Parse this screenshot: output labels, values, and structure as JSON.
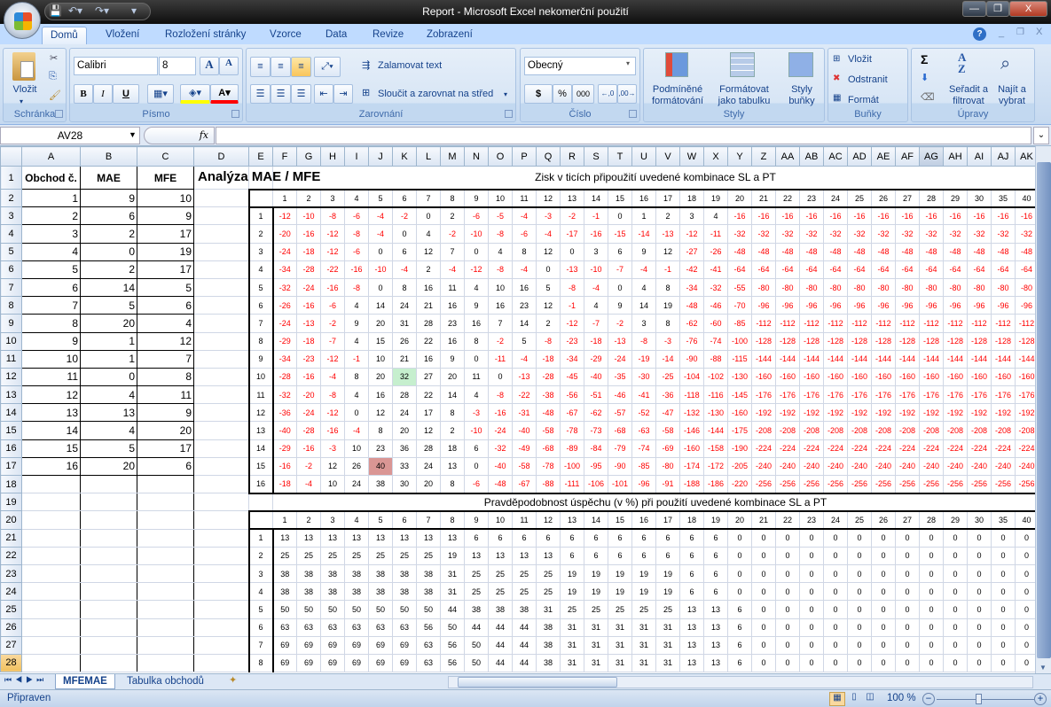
{
  "window": {
    "title": "Report - Microsoft Excel nekomerční použití",
    "minimize": "—",
    "restore": "❐",
    "close": "X"
  },
  "quick_access": {
    "save_icon": "save-icon",
    "undo_icon": "undo-icon",
    "redo_icon": "redo-icon"
  },
  "ribbon_tabs": [
    "Domů",
    "Vložení",
    "Rozložení stránky",
    "Vzorce",
    "Data",
    "Revize",
    "Zobrazení"
  ],
  "ribbon": {
    "clipboard": {
      "label": "Schránka",
      "paste": "Vložit"
    },
    "font": {
      "label": "Písmo",
      "font_name": "Calibri",
      "font_size": "8",
      "bold": "B",
      "italic": "I",
      "underline": "U",
      "font_color": "#ff0000",
      "fill_color": "#ffff00"
    },
    "alignment": {
      "label": "Zarovnání",
      "wrap_text": "Zalamovat text",
      "merge_center": "Sloučit a zarovnat na střed"
    },
    "number": {
      "label": "Číslo",
      "format": "Obecný",
      "currency": "$",
      "percent": "%",
      "thousands": "000"
    },
    "styles": {
      "label": "Styly",
      "conditional_1": "Podmíněné",
      "conditional_2": "formátování",
      "table_1": "Formátovat",
      "table_2": "jako tabulku",
      "cell_1": "Styly",
      "cell_2": "buňky"
    },
    "cells": {
      "label": "Buňky",
      "insert": "Vložit",
      "delete": "Odstranit",
      "format": "Formát"
    },
    "editing": {
      "label": "Úpravy",
      "sort_1": "Seřadit a",
      "sort_2": "filtrovat",
      "find_1": "Najít a",
      "find_2": "vybrat",
      "sum": "Σ"
    }
  },
  "formula_bar": {
    "name_box": "AV28",
    "fx": "fx",
    "formula": ""
  },
  "sheet": {
    "columns": [
      "A",
      "B",
      "C",
      "D",
      "E",
      "F",
      "G",
      "H",
      "I",
      "J",
      "K",
      "L",
      "M",
      "N",
      "O",
      "P",
      "Q",
      "R",
      "S",
      "T",
      "U",
      "V",
      "W",
      "X",
      "Y",
      "Z",
      "AA",
      "AB",
      "AC",
      "AD",
      "AE",
      "AF",
      "AG",
      "AH",
      "AI",
      "AJ",
      "AK"
    ],
    "rows": [
      1,
      2,
      3,
      4,
      5,
      6,
      7,
      8,
      9,
      10,
      11,
      12,
      13,
      14,
      15,
      16,
      17,
      18,
      19,
      20,
      21,
      22,
      23,
      24,
      25,
      26,
      27,
      28
    ],
    "selected_row": 28,
    "hover_column": "AG",
    "trades": {
      "headers": [
        "Obchod č.",
        "MAE",
        "MFE"
      ],
      "rows": [
        [
          1,
          9,
          10
        ],
        [
          2,
          6,
          9
        ],
        [
          3,
          2,
          17
        ],
        [
          4,
          0,
          19
        ],
        [
          5,
          2,
          17
        ],
        [
          6,
          14,
          5
        ],
        [
          7,
          5,
          6
        ],
        [
          8,
          20,
          4
        ],
        [
          9,
          1,
          12
        ],
        [
          10,
          1,
          7
        ],
        [
          11,
          0,
          8
        ],
        [
          12,
          4,
          11
        ],
        [
          13,
          13,
          9
        ],
        [
          14,
          4,
          20
        ],
        [
          15,
          5,
          17
        ],
        [
          16,
          20,
          6
        ]
      ]
    },
    "analysis_title": "Analýza MAE / MFE",
    "profit_table": {
      "title": "Zisk v ticích připoužití uvedené kombinace SL a PT",
      "pt_values": [
        1,
        2,
        3,
        4,
        5,
        6,
        7,
        8,
        9,
        10,
        11,
        12,
        13,
        14,
        15,
        16,
        17,
        18,
        19,
        20,
        21,
        22,
        23,
        24,
        25,
        26,
        27,
        28,
        29,
        30,
        35,
        40
      ],
      "sl_values": [
        1,
        2,
        3,
        4,
        5,
        6,
        7,
        8,
        9,
        10,
        11,
        12,
        13,
        14,
        15,
        16
      ],
      "values": [
        [
          -12,
          -10,
          -8,
          -6,
          -4,
          -2,
          0,
          2,
          -6,
          -5,
          -4,
          -3,
          -2,
          -1,
          0,
          1,
          2,
          3,
          4,
          -16,
          -16,
          -16,
          -16,
          -16,
          -16,
          -16,
          -16,
          -16,
          -16,
          -16,
          -16,
          -16
        ],
        [
          -20,
          -16,
          -12,
          -8,
          -4,
          0,
          4,
          -2,
          -10,
          -8,
          -6,
          -4,
          -17,
          -16,
          -15,
          -14,
          -13,
          -12,
          -11,
          -32,
          -32,
          -32,
          -32,
          -32,
          -32,
          -32,
          -32,
          -32,
          -32,
          -32,
          -32,
          -32
        ],
        [
          -24,
          -18,
          -12,
          -6,
          0,
          6,
          12,
          7,
          0,
          4,
          8,
          12,
          0,
          3,
          6,
          9,
          12,
          -27,
          -26,
          -48,
          -48,
          -48,
          -48,
          -48,
          -48,
          -48,
          -48,
          -48,
          -48,
          -48,
          -48,
          -48
        ],
        [
          -34,
          -28,
          -22,
          -16,
          -10,
          -4,
          2,
          -4,
          -12,
          -8,
          -4,
          0,
          -13,
          -10,
          -7,
          -4,
          -1,
          -42,
          -41,
          -64,
          -64,
          -64,
          -64,
          -64,
          -64,
          -64,
          -64,
          -64,
          -64,
          -64,
          -64,
          -64
        ],
        [
          -32,
          -24,
          -16,
          -8,
          0,
          8,
          16,
          11,
          4,
          10,
          16,
          5,
          -8,
          -4,
          0,
          4,
          8,
          -34,
          -32,
          -55,
          -80,
          -80,
          -80,
          -80,
          -80,
          -80,
          -80,
          -80,
          -80,
          -80,
          -80,
          -80
        ],
        [
          -26,
          -16,
          -6,
          4,
          14,
          24,
          21,
          16,
          9,
          16,
          23,
          12,
          -1,
          4,
          9,
          14,
          19,
          -48,
          -46,
          -70,
          -96,
          -96,
          -96,
          -96,
          -96,
          -96,
          -96,
          -96,
          -96,
          -96,
          -96,
          -96
        ],
        [
          -24,
          -13,
          -2,
          9,
          20,
          31,
          28,
          23,
          16,
          7,
          14,
          2,
          -12,
          -7,
          -2,
          3,
          8,
          -62,
          -60,
          -85,
          -112,
          -112,
          -112,
          -112,
          -112,
          -112,
          -112,
          -112,
          -112,
          -112,
          -112,
          -112
        ],
        [
          -29,
          -18,
          -7,
          4,
          15,
          26,
          22,
          16,
          8,
          -2,
          5,
          -8,
          -23,
          -18,
          -13,
          -8,
          -3,
          -76,
          -74,
          -100,
          -128,
          -128,
          -128,
          -128,
          -128,
          -128,
          -128,
          -128,
          -128,
          -128,
          -128,
          -128
        ],
        [
          -34,
          -23,
          -12,
          -1,
          10,
          21,
          16,
          9,
          0,
          -11,
          -4,
          -18,
          -34,
          -29,
          -24,
          -19,
          -14,
          -90,
          -88,
          -115,
          -144,
          -144,
          -144,
          -144,
          -144,
          -144,
          -144,
          -144,
          -144,
          -144,
          -144,
          -144
        ],
        [
          -28,
          -16,
          -4,
          8,
          20,
          32,
          27,
          20,
          11,
          0,
          -13,
          -28,
          -45,
          -40,
          -35,
          -30,
          -25,
          -104,
          -102,
          -130,
          -160,
          -160,
          -160,
          -160,
          -160,
          -160,
          -160,
          -160,
          -160,
          -160,
          -160,
          -160
        ],
        [
          -32,
          -20,
          -8,
          4,
          16,
          28,
          22,
          14,
          4,
          -8,
          -22,
          -38,
          -56,
          -51,
          -46,
          -41,
          -36,
          -118,
          -116,
          -145,
          -176,
          -176,
          -176,
          -176,
          -176,
          -176,
          -176,
          -176,
          -176,
          -176,
          -176,
          -176
        ],
        [
          -36,
          -24,
          -12,
          0,
          12,
          24,
          17,
          8,
          -3,
          -16,
          -31,
          -48,
          -67,
          -62,
          -57,
          -52,
          -47,
          -132,
          -130,
          -160,
          -192,
          -192,
          -192,
          -192,
          -192,
          -192,
          -192,
          -192,
          -192,
          -192,
          -192,
          -192
        ],
        [
          -40,
          -28,
          -16,
          -4,
          8,
          20,
          12,
          2,
          -10,
          -24,
          -40,
          -58,
          -78,
          -73,
          -68,
          -63,
          -58,
          -146,
          -144,
          -175,
          -208,
          -208,
          -208,
          -208,
          -208,
          -208,
          -208,
          -208,
          -208,
          -208,
          -208,
          -208
        ],
        [
          -29,
          -16,
          -3,
          10,
          23,
          36,
          28,
          18,
          6,
          -32,
          -49,
          -68,
          -89,
          -84,
          -79,
          -74,
          -69,
          -160,
          -158,
          -190,
          -224,
          -224,
          -224,
          -224,
          -224,
          -224,
          -224,
          -224,
          -224,
          -224,
          -224,
          -224
        ],
        [
          -16,
          -2,
          12,
          26,
          40,
          33,
          24,
          13,
          0,
          -40,
          -58,
          -78,
          -100,
          -95,
          -90,
          -85,
          -80,
          -174,
          -172,
          -205,
          -240,
          -240,
          -240,
          -240,
          -240,
          -240,
          -240,
          -240,
          -240,
          -240,
          -240,
          -240
        ],
        [
          -18,
          -4,
          10,
          24,
          38,
          30,
          20,
          8,
          -6,
          -48,
          -67,
          -88,
          -111,
          -106,
          -101,
          -96,
          -91,
          -188,
          -186,
          -220,
          -256,
          -256,
          -256,
          -256,
          -256,
          -256,
          -256,
          -256,
          -256,
          -256,
          -256,
          -256
        ]
      ],
      "highlights": [
        {
          "sl": 10,
          "pt": 6,
          "color": "#c6efce"
        },
        {
          "sl": 15,
          "pt": 5,
          "color": "#da9694"
        }
      ]
    },
    "probability_table": {
      "title": "Pravděpodobnost úspěchu (v %) při použití uvedené kombinace SL a PT",
      "pt_values": [
        1,
        2,
        3,
        4,
        5,
        6,
        7,
        8,
        9,
        10,
        11,
        12,
        13,
        14,
        15,
        16,
        17,
        18,
        19,
        20,
        21,
        22,
        23,
        24,
        25,
        26,
        27,
        28,
        29,
        30,
        35,
        40
      ],
      "sl_values": [
        1,
        2,
        3,
        4,
        5,
        6,
        7,
        8
      ],
      "values": [
        [
          13,
          13,
          13,
          13,
          13,
          13,
          13,
          13,
          6,
          6,
          6,
          6,
          6,
          6,
          6,
          6,
          6,
          6,
          6,
          0,
          0,
          0,
          0,
          0,
          0,
          0,
          0,
          0,
          0,
          0,
          0,
          0
        ],
        [
          25,
          25,
          25,
          25,
          25,
          25,
          25,
          19,
          13,
          13,
          13,
          13,
          6,
          6,
          6,
          6,
          6,
          6,
          6,
          0,
          0,
          0,
          0,
          0,
          0,
          0,
          0,
          0,
          0,
          0,
          0,
          0
        ],
        [
          38,
          38,
          38,
          38,
          38,
          38,
          38,
          31,
          25,
          25,
          25,
          25,
          19,
          19,
          19,
          19,
          19,
          6,
          6,
          0,
          0,
          0,
          0,
          0,
          0,
          0,
          0,
          0,
          0,
          0,
          0,
          0
        ],
        [
          38,
          38,
          38,
          38,
          38,
          38,
          38,
          31,
          25,
          25,
          25,
          25,
          19,
          19,
          19,
          19,
          19,
          6,
          6,
          0,
          0,
          0,
          0,
          0,
          0,
          0,
          0,
          0,
          0,
          0,
          0,
          0
        ],
        [
          50,
          50,
          50,
          50,
          50,
          50,
          50,
          44,
          38,
          38,
          38,
          31,
          25,
          25,
          25,
          25,
          25,
          13,
          13,
          6,
          0,
          0,
          0,
          0,
          0,
          0,
          0,
          0,
          0,
          0,
          0,
          0
        ],
        [
          63,
          63,
          63,
          63,
          63,
          63,
          56,
          50,
          44,
          44,
          44,
          38,
          31,
          31,
          31,
          31,
          31,
          13,
          13,
          6,
          0,
          0,
          0,
          0,
          0,
          0,
          0,
          0,
          0,
          0,
          0,
          0
        ],
        [
          69,
          69,
          69,
          69,
          69,
          69,
          63,
          56,
          50,
          44,
          44,
          38,
          31,
          31,
          31,
          31,
          31,
          13,
          13,
          6,
          0,
          0,
          0,
          0,
          0,
          0,
          0,
          0,
          0,
          0,
          0,
          0
        ],
        [
          69,
          69,
          69,
          69,
          69,
          69,
          63,
          56,
          50,
          44,
          44,
          38,
          31,
          31,
          31,
          31,
          31,
          13,
          13,
          6,
          0,
          0,
          0,
          0,
          0,
          0,
          0,
          0,
          0,
          0,
          0,
          0
        ]
      ]
    }
  },
  "sheet_tabs": [
    "MFEMAE",
    "Tabulka obchodů"
  ],
  "status": {
    "text": "Připraven",
    "zoom": "100 %"
  }
}
